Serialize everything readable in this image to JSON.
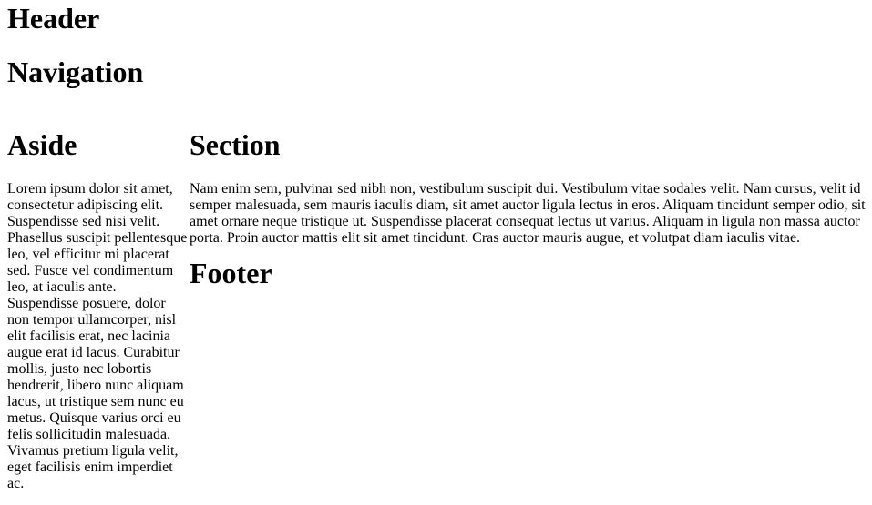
{
  "header": {
    "title": "Header"
  },
  "nav": {
    "title": "Navigation"
  },
  "aside": {
    "title": "Aside",
    "text": "Lorem ipsum dolor sit amet, consectetur adipiscing elit. Suspendisse sed nisi velit. Phasellus suscipit pellentesque leo, vel efficitur mi placerat sed. Fusce vel condimentum leo, at iaculis ante. Suspendisse posuere, dolor non tempor ullamcorper, nisl elit facilisis erat, nec lacinia augue erat id lacus. Curabitur mollis, justo nec lobortis hendrerit, libero nunc aliquam lacus, ut tristique sem nunc eu metus. Quisque varius orci eu felis sollicitudin malesuada. Vivamus pretium ligula velit, eget facilisis enim imperdiet ac."
  },
  "section": {
    "title": "Section",
    "text": "Nam enim sem, pulvinar sed nibh non, vestibulum suscipit dui. Vestibulum vitae sodales velit. Nam cursus, velit id semper malesuada, sem mauris iaculis diam, sit amet auctor ligula lectus in eros. Aliquam tincidunt semper odio, sit amet ornare neque tristique ut. Suspendisse placerat consequat lectus ut varius. Aliquam in ligula non massa auctor porta. Proin auctor mattis elit sit amet tincidunt. Cras auctor mauris augue, et volutpat diam iaculis vitae."
  },
  "footer": {
    "title": "Footer"
  }
}
